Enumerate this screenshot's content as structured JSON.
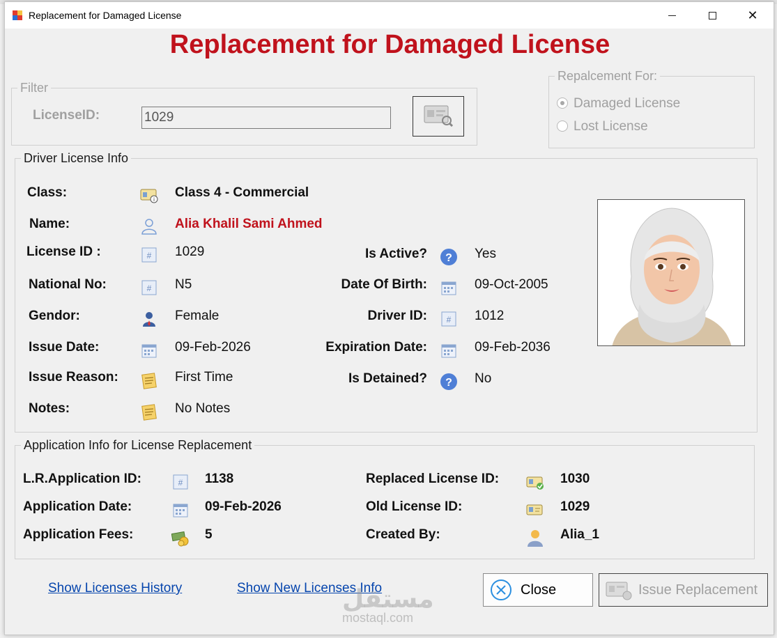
{
  "window": {
    "title": "Replacement for Damaged License",
    "minimize_icon": "minimize-icon",
    "maximize_icon": "maximize-icon",
    "close_glyph": "✕"
  },
  "header": {
    "title": "Replacement for Damaged License"
  },
  "filter": {
    "legend": "Filter",
    "license_id_label": "LicenseID:",
    "license_id_value": "1029",
    "search_icon": "license-search-icon"
  },
  "replacement_for": {
    "legend": "Repalcement For:",
    "options": [
      {
        "label": "Damaged License",
        "checked": true
      },
      {
        "label": "Lost License",
        "checked": false
      }
    ]
  },
  "driver_info": {
    "legend": "Driver License Info",
    "class_label": "Class:",
    "class_value": "Class 4 - Commercial",
    "name_label": "Name:",
    "name_value": "Alia Khalil Sami Ahmed",
    "license_id_label": "License ID :",
    "license_id_value": "1029",
    "is_active_label": "Is Active?",
    "is_active_value": "Yes",
    "national_no_label": "National No:",
    "national_no_value": "N5",
    "dob_label": "Date Of Birth:",
    "dob_value": "09-Oct-2005",
    "gender_label": "Gendor:",
    "gender_value": "Female",
    "driver_id_label": "Driver ID:",
    "driver_id_value": "1012",
    "issue_date_label": "Issue Date:",
    "issue_date_value": "09-Feb-2026",
    "expiration_label": "Expiration Date:",
    "expiration_value": "09-Feb-2036",
    "issue_reason_label": "Issue Reason:",
    "issue_reason_value": "First Time",
    "is_detained_label": "Is Detained?",
    "is_detained_value": "No",
    "notes_label": "Notes:",
    "notes_value": "No Notes"
  },
  "application_info": {
    "legend": "Application Info for License Replacement",
    "app_id_label": "L.R.Application ID:",
    "app_id_value": "1138",
    "app_date_label": "Application Date:",
    "app_date_value": "09-Feb-2026",
    "fees_label": "Application Fees:",
    "fees_value": "5",
    "replaced_label": "Replaced License ID:",
    "replaced_value": "1030",
    "old_label": "Old License ID:",
    "old_value": "1029",
    "created_by_label": "Created By:",
    "created_by_value": "Alia_1"
  },
  "footer": {
    "history_link": "Show Licenses History",
    "new_info_link": "Show New Licenses Info",
    "close_label": "Close",
    "issue_label": "Issue Replacement",
    "watermark_ar": "مستقل",
    "watermark_en": "mostaql.com"
  },
  "colors": {
    "accent_red": "#c0121c",
    "link_blue": "#0645ad",
    "disabled": "#a0a0a0"
  }
}
